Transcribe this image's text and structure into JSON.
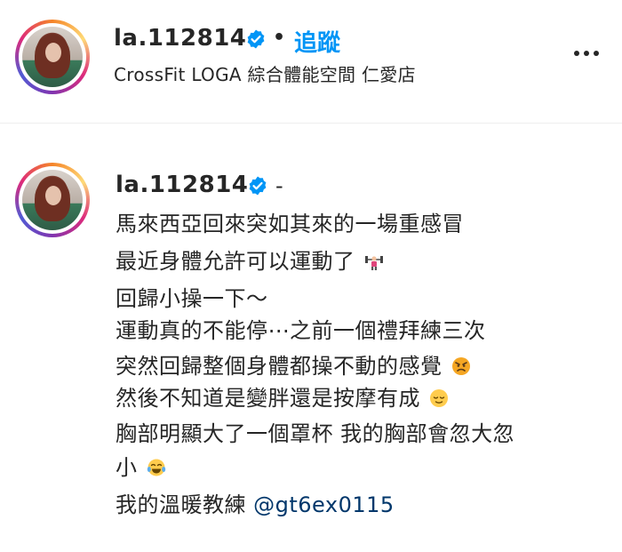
{
  "header": {
    "username": "la.112814",
    "separator": "•",
    "follow_label": "追蹤",
    "location": "CrossFit LOGA 綜合體能空間 仁愛店"
  },
  "caption": {
    "username": "la.112814",
    "dash": "-",
    "lines": [
      "馬來西亞回來突如其來的一場重感冒",
      "最近身體允許可以運動了",
      "回歸小操一下～",
      "運動真的不能停⋯之前一個禮拜練三次",
      "突然回歸整個身體都操不動的感覺",
      "然後不知道是變胖還是按摩有成",
      "胸部明顯大了一個罩杯 我的胸部會忽大忽",
      "小",
      "我的溫暖教練 "
    ],
    "mention": "@gt6ex0115"
  },
  "icons": {
    "verified": "verified-badge-icon",
    "more": "more-options-icon",
    "weightlifter": "weightlifter-emoji-icon",
    "angry": "angry-face-emoji-icon",
    "relieved": "relieved-face-emoji-icon",
    "laughing": "tears-of-joy-emoji-icon"
  },
  "colors": {
    "accent": "#0095f6",
    "mention": "#00376b",
    "text": "#262626"
  }
}
